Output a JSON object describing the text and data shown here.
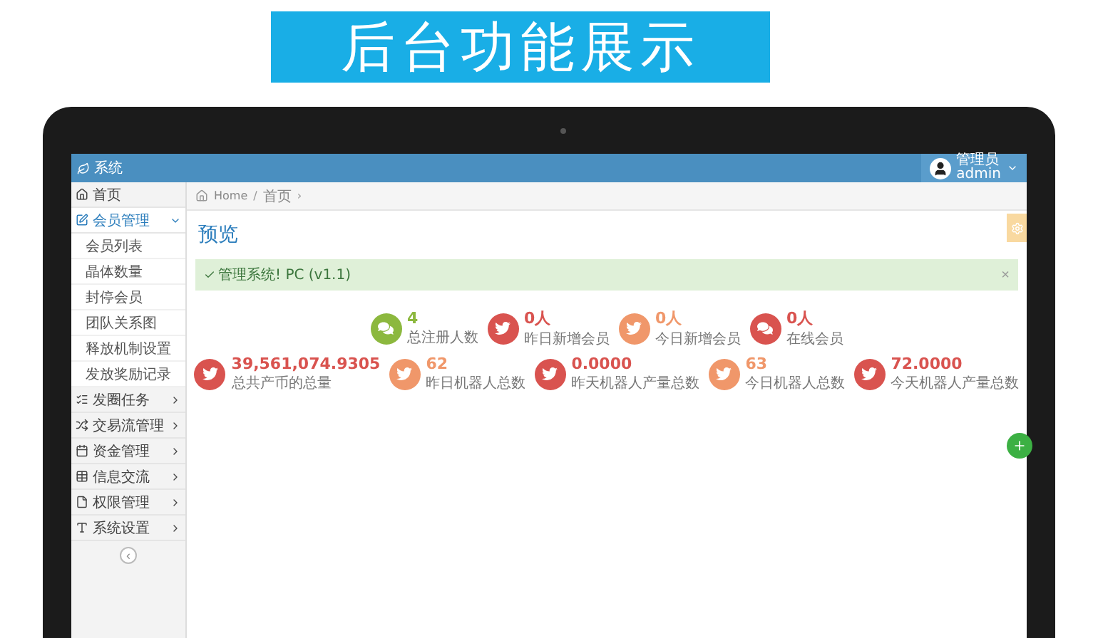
{
  "banner": {
    "title": "后台功能展示"
  },
  "header": {
    "app_name": "系统",
    "user_role": "管理员",
    "user_name": "admin"
  },
  "sidebar": {
    "items": [
      {
        "label": "首页",
        "selected": false
      },
      {
        "label": "会员管理",
        "selected": true,
        "expanded": true,
        "children": [
          {
            "label": "会员列表"
          },
          {
            "label": "晶体数量"
          },
          {
            "label": "封停会员"
          },
          {
            "label": "团队关系图"
          },
          {
            "label": "释放机制设置"
          },
          {
            "label": "发放奖励记录"
          }
        ]
      },
      {
        "label": "发圈任务",
        "selected": false,
        "expanded": false
      },
      {
        "label": "交易流管理",
        "selected": false,
        "expanded": false
      },
      {
        "label": "资金管理",
        "selected": false,
        "expanded": false
      },
      {
        "label": "信息交流",
        "selected": false,
        "expanded": false
      },
      {
        "label": "权限管理",
        "selected": false,
        "expanded": false
      },
      {
        "label": "系统设置",
        "selected": false,
        "expanded": false
      }
    ],
    "collapse_label": "‹"
  },
  "breadcrumb": [
    {
      "kind": "link",
      "text": "Home"
    },
    {
      "kind": "sep",
      "text": "/"
    },
    {
      "kind": "link",
      "text": "首页"
    },
    {
      "kind": "sep",
      "text": "›"
    }
  ],
  "page_title": "预览",
  "alert": {
    "text": "管理系统! PC (v1.1)",
    "close": "×"
  },
  "stats": [
    [
      {
        "kind": "chat",
        "color": "#8cb83e",
        "value": "4",
        "label": "总注册人数"
      },
      {
        "kind": "bird",
        "color": "#d9534f",
        "value": "0人",
        "label": "昨日新增会员"
      },
      {
        "kind": "bird",
        "color": "#f0976a",
        "value": "0人",
        "label": "今日新增会员"
      },
      {
        "kind": "chat",
        "color": "#d9534f",
        "value": "0人",
        "label": "在线会员"
      }
    ],
    [
      {
        "kind": "bird",
        "color": "#d9534f",
        "value": "39,561,074.9305",
        "label": "总共产币的总量"
      },
      {
        "kind": "bird",
        "color": "#f0976a",
        "value": "62",
        "label": "昨日机器人总数"
      },
      {
        "kind": "bird",
        "color": "#d9534f",
        "value": "0.0000",
        "label": "昨天机器人产量总数"
      },
      {
        "kind": "bird",
        "color": "#f0976a",
        "value": "63",
        "label": "今日机器人总数"
      },
      {
        "kind": "bird",
        "color": "#d9534f",
        "value": "72.0000",
        "label": "今天机器人产量总数"
      }
    ]
  ]
}
